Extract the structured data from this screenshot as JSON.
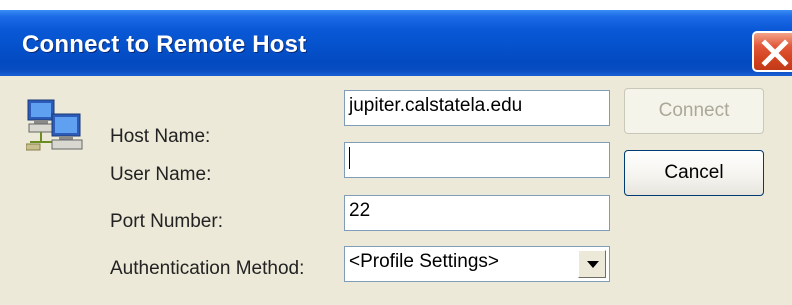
{
  "window": {
    "title": "Connect to Remote Host",
    "close_label": "Close"
  },
  "form": {
    "host_name_label": "Host Name:",
    "host_name_value": "jupiter.calstatela.edu",
    "user_name_label": "User Name:",
    "user_name_value": "",
    "port_number_label": "Port Number:",
    "port_number_value": "22",
    "auth_method_label": "Authentication Method:",
    "auth_method_value": "<Profile Settings>"
  },
  "buttons": {
    "connect_label": "Connect",
    "connect_enabled": false,
    "cancel_label": "Cancel"
  },
  "icons": {
    "dialog_icon": "networked-computers-icon",
    "close_icon": "close-icon",
    "dropdown_icon": "chevron-down-icon"
  },
  "colors": {
    "titlebar": "#0552cc",
    "close_button": "#d2431e",
    "dialog_background": "#ece9d8"
  }
}
